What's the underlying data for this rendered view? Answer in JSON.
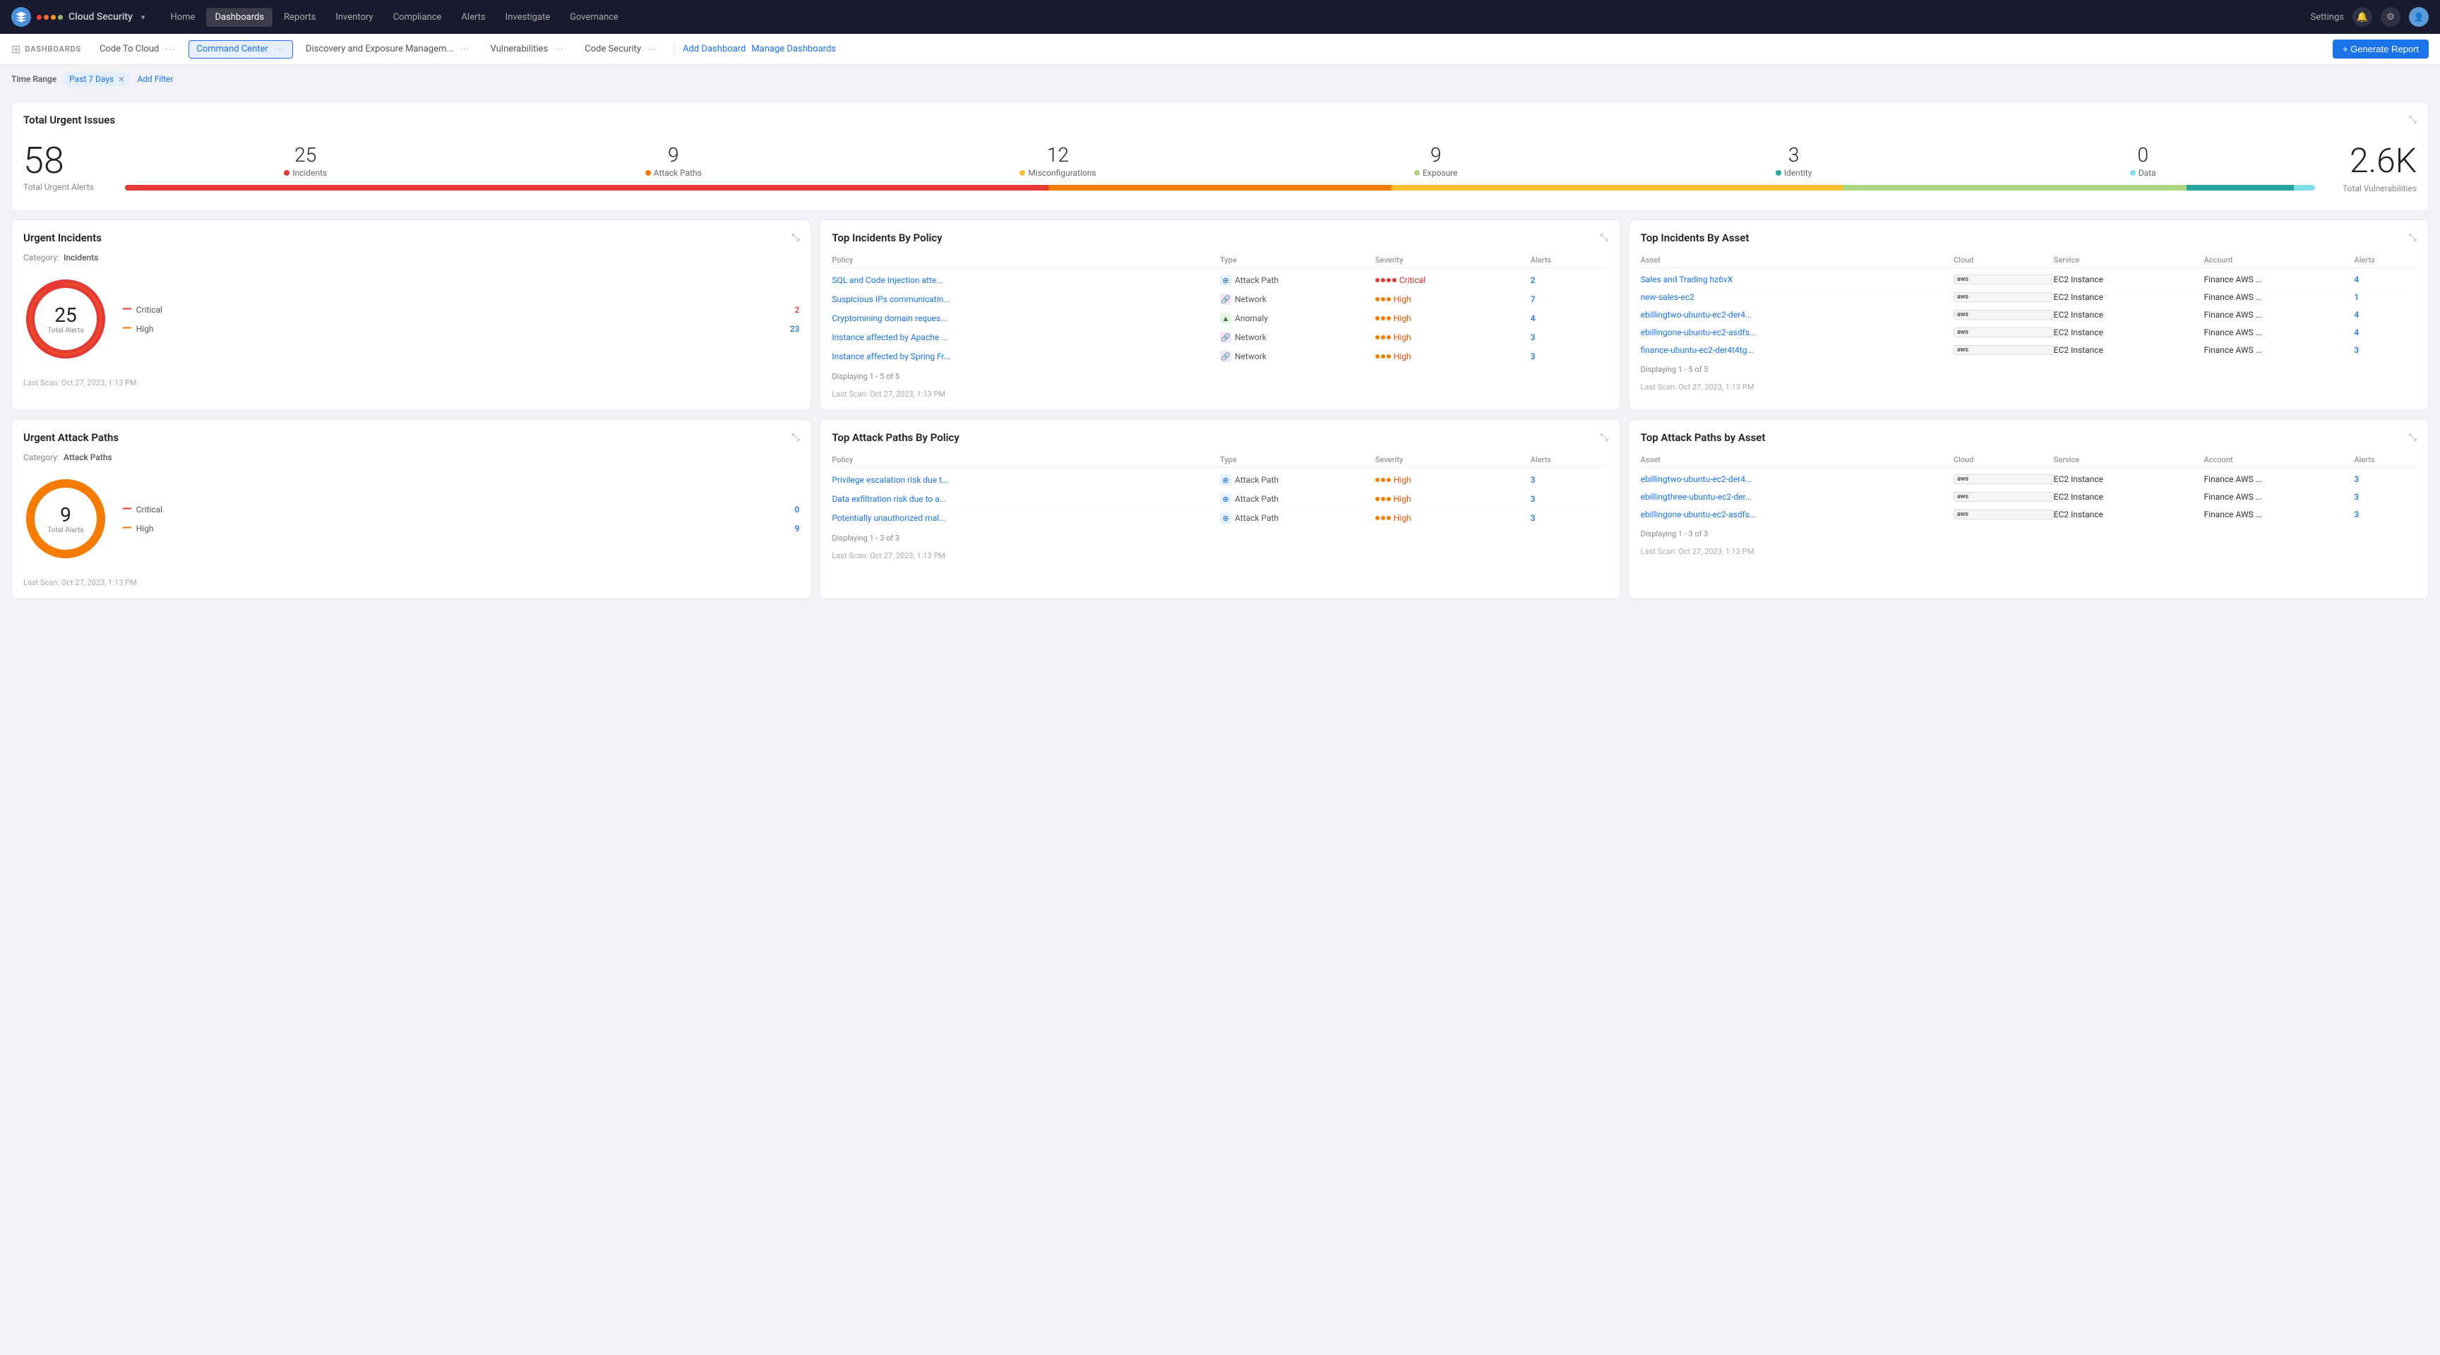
{
  "brand": {
    "name": "Cloud Security",
    "dots": [
      "#f94144",
      "#f3722c",
      "#f8961e",
      "#90be6d",
      "#43aa8b"
    ],
    "logo_color": "#4a90d9"
  },
  "nav": {
    "links": [
      "Home",
      "Dashboards",
      "Reports",
      "Inventory",
      "Compliance",
      "Alerts",
      "Investigate",
      "Governance"
    ],
    "active_link": "Dashboards",
    "settings_label": "Settings",
    "icon_labels": [
      "notifications-icon",
      "settings-gear-icon",
      "avatar-icon"
    ]
  },
  "dashboards_bar": {
    "label": "DASHBOARDS",
    "tabs": [
      {
        "id": "code-to-cloud",
        "label": "Code To Cloud",
        "active": false
      },
      {
        "id": "command-center",
        "label": "Command Center",
        "active": true
      },
      {
        "id": "discovery",
        "label": "Discovery and Exposure Managem...",
        "active": false
      },
      {
        "id": "vulnerabilities",
        "label": "Vulnerabilities",
        "active": false
      },
      {
        "id": "code-security",
        "label": "Code Security",
        "active": false
      }
    ],
    "add_dashboard": "Add Dashboard",
    "manage_dashboards": "Manage Dashboards",
    "generate_btn": "+ Generate Report"
  },
  "filters": {
    "label": "Time Range",
    "tag": "Past 7 Days",
    "add_filter": "Add Filter"
  },
  "urgent_issues": {
    "title": "Total Urgent Issues",
    "total_alerts_num": "58",
    "total_alerts_label": "Total Urgent Alerts",
    "categories": [
      {
        "num": "25",
        "label": "Incidents",
        "color": "#e53935"
      },
      {
        "num": "9",
        "label": "Attack Paths",
        "color": "#f57c00"
      },
      {
        "num": "12",
        "label": "Misconfigurations",
        "color": "#fbc02d"
      },
      {
        "num": "9",
        "label": "Exposure",
        "color": "#aed581"
      },
      {
        "num": "3",
        "label": "Identity",
        "color": "#26a69a"
      },
      {
        "num": "0",
        "label": "Data",
        "color": "#80deea"
      }
    ],
    "progress_segments": [
      {
        "pct": 43,
        "color": "#e53935"
      },
      {
        "pct": 16,
        "color": "#f57c00"
      },
      {
        "pct": 21,
        "color": "#fbc02d"
      },
      {
        "pct": 16,
        "color": "#aed581"
      },
      {
        "pct": 5,
        "color": "#26a69a"
      },
      {
        "pct": 0,
        "color": "#80deea"
      }
    ],
    "total_vuln_num": "2.6K",
    "total_vuln_label": "Total Vulnerabilities"
  },
  "urgent_incidents": {
    "title": "Urgent Incidents",
    "category_label": "Incidents",
    "total": 25,
    "donut_color": "#e53935",
    "donut_bg": "#f9e9e9",
    "severity_rows": [
      {
        "dash_color": "#e53935",
        "label": "Critical",
        "count": "2",
        "count_color": "red"
      },
      {
        "dash_color": "#f57c00",
        "label": "High",
        "count": "23",
        "count_color": "blue"
      }
    ],
    "scan_label": "Last Scan: Oct 27, 2023, 1:13 PM"
  },
  "top_incidents_policy": {
    "title": "Top Incidents By Policy",
    "headers": [
      "Policy",
      "Type",
      "Severity",
      "Alerts"
    ],
    "rows": [
      {
        "policy": "SQL and Code Injection atte...",
        "type": "Attack Path",
        "type_icon": "attack",
        "severity": "Critical",
        "sev_color": "critical",
        "alerts": "2"
      },
      {
        "policy": "Suspicious IPs communicatin...",
        "type": "Network",
        "type_icon": "network",
        "severity": "High",
        "sev_color": "high",
        "alerts": "7"
      },
      {
        "policy": "Cryptomining domain reques...",
        "type": "Anomaly",
        "type_icon": "anomaly",
        "severity": "High",
        "sev_color": "high",
        "alerts": "4"
      },
      {
        "policy": "Instance affected by Apache ...",
        "type": "Network",
        "type_icon": "network",
        "severity": "High",
        "sev_color": "high",
        "alerts": "3"
      },
      {
        "policy": "Instance affected by Spring Fr...",
        "type": "Network",
        "type_icon": "network",
        "severity": "High",
        "sev_color": "high",
        "alerts": "3"
      }
    ],
    "displaying": "Displaying 1 - 5 of 5",
    "scan_label": "Last Scan: Oct 27, 2023, 1:13 PM"
  },
  "top_incidents_asset": {
    "title": "Top Incidents By Asset",
    "headers": [
      "Asset",
      "Cloud",
      "Service",
      "Account",
      "Alerts"
    ],
    "rows": [
      {
        "asset": "Sales and Trading hz6vX",
        "cloud": "aws",
        "service": "EC2 Instance",
        "account": "Finance AWS ...",
        "alerts": "4"
      },
      {
        "asset": "new-sales-ec2",
        "cloud": "aws",
        "service": "EC2 Instance",
        "account": "Finance AWS ...",
        "alerts": "1"
      },
      {
        "asset": "ebillingtwo-ubuntu-ec2-der4...",
        "cloud": "aws",
        "service": "EC2 Instance",
        "account": "Finance AWS ...",
        "alerts": "4"
      },
      {
        "asset": "ebillingone-ubuntu-ec2-asdfs...",
        "cloud": "aws",
        "service": "EC2 Instance",
        "account": "Finance AWS ...",
        "alerts": "4"
      },
      {
        "asset": "finance-ubuntu-ec2-der4t4tg...",
        "cloud": "aws",
        "service": "EC2 Instance",
        "account": "Finance AWS ...",
        "alerts": "3"
      }
    ],
    "displaying": "Displaying 1 - 5 of 5",
    "scan_label": "Last Scan: Oct 27, 2023, 1:13 PM"
  },
  "urgent_attack_paths": {
    "title": "Urgent Attack Paths",
    "category_label": "Attack Paths",
    "total": 9,
    "donut_color": "#f57c00",
    "donut_bg": "#fff3e0",
    "severity_rows": [
      {
        "dash_color": "#e53935",
        "label": "Critical",
        "count": "0",
        "count_color": "blue"
      },
      {
        "dash_color": "#f57c00",
        "label": "High",
        "count": "9",
        "count_color": "blue"
      }
    ],
    "scan_label": "Last Scan: Oct 27, 2023, 1:13 PM"
  },
  "top_attack_policy": {
    "title": "Top Attack Paths By Policy",
    "headers": [
      "Policy",
      "Type",
      "Severity",
      "Alerts"
    ],
    "rows": [
      {
        "policy": "Privilege escalation risk due t...",
        "type": "Attack Path",
        "type_icon": "attack",
        "severity": "High",
        "sev_color": "high",
        "alerts": "3"
      },
      {
        "policy": "Data exfiltration risk due to a...",
        "type": "Attack Path",
        "type_icon": "attack",
        "severity": "High",
        "sev_color": "high",
        "alerts": "3"
      },
      {
        "policy": "Potentially unauthorized mal...",
        "type": "Attack Path",
        "type_icon": "attack",
        "severity": "High",
        "sev_color": "high",
        "alerts": "3"
      }
    ],
    "displaying": "Displaying 1 - 3 of 3",
    "scan_label": "Last Scan: Oct 27, 2023, 1:13 PM"
  },
  "top_attack_asset": {
    "title": "Top Attack Paths by Asset",
    "headers": [
      "Asset",
      "Cloud",
      "Service",
      "Account",
      "Alerts"
    ],
    "rows": [
      {
        "asset": "ebillingtwo-ubuntu-ec2-der4...",
        "cloud": "aws",
        "service": "EC2 Instance",
        "account": "Finance AWS ...",
        "alerts": "3"
      },
      {
        "asset": "ebillingthree-ubuntu-ec2-der...",
        "cloud": "aws",
        "service": "EC2 Instance",
        "account": "Finance AWS ...",
        "alerts": "3"
      },
      {
        "asset": "ebillingone-ubuntu-ec2-asdfs...",
        "cloud": "aws",
        "service": "EC2 Instance",
        "account": "Finance AWS ...",
        "alerts": "3"
      }
    ],
    "displaying": "Displaying 1 - 3 of 3",
    "scan_label": "Last Scan: Oct 27, 2023, 1:13 PM"
  },
  "colors": {
    "accent": "#1a73e8",
    "critical_red": "#e53935",
    "high_orange": "#f57c00"
  }
}
